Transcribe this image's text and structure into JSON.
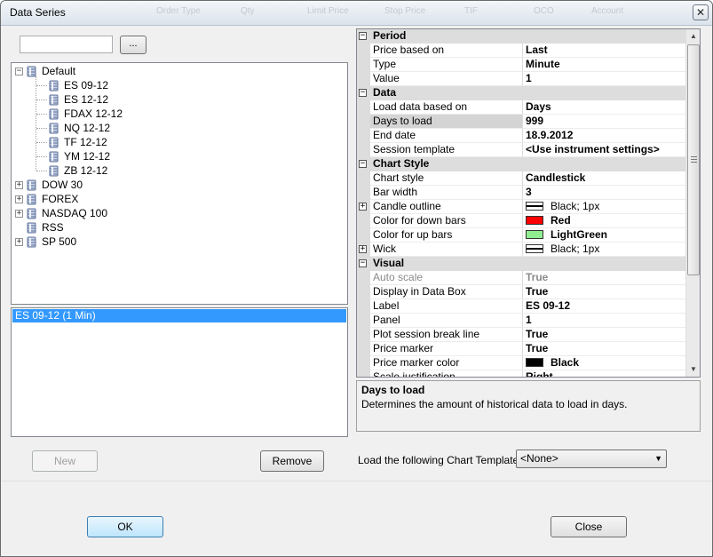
{
  "window": {
    "title": "Data Series",
    "close_glyph": "✕",
    "background_menu": [
      "Order Type",
      "Qty",
      "Limit Price",
      "Stop Price",
      "TIF",
      "OCO",
      "Account"
    ]
  },
  "search": {
    "value": "",
    "browse_label": "..."
  },
  "tree": [
    {
      "label": "Default",
      "expanded": true,
      "toggle": "−",
      "children": [
        "ES 09-12",
        "ES 12-12",
        "FDAX 12-12",
        "NQ 12-12",
        "TF 12-12",
        "YM 12-12",
        "ZB 12-12"
      ]
    },
    {
      "label": "DOW 30",
      "expanded": false,
      "toggle": "+"
    },
    {
      "label": "FOREX",
      "expanded": false,
      "toggle": "+"
    },
    {
      "label": "NASDAQ 100",
      "expanded": false,
      "toggle": "+"
    },
    {
      "label": "RSS",
      "expanded": false,
      "toggle": ""
    },
    {
      "label": "SP 500",
      "expanded": false,
      "toggle": "+"
    }
  ],
  "series_list": {
    "items": [
      "ES 09-12 (1 Min)"
    ]
  },
  "buttons": {
    "new": "New",
    "remove": "Remove",
    "ok": "OK",
    "close": "Close"
  },
  "properties": [
    {
      "category": "Period",
      "rows": [
        {
          "name": "Price based on",
          "value": "Last"
        },
        {
          "name": "Type",
          "value": "Minute"
        },
        {
          "name": "Value",
          "value": "1"
        }
      ]
    },
    {
      "category": "Data",
      "rows": [
        {
          "name": "Load data based on",
          "value": "Days"
        },
        {
          "name": "Days to load",
          "value": "999",
          "selected": true
        },
        {
          "name": "End date",
          "value": "18.9.2012"
        },
        {
          "name": "Session template",
          "value": "<Use instrument settings>"
        }
      ]
    },
    {
      "category": "Chart Style",
      "rows": [
        {
          "name": "Chart style",
          "value": "Candlestick"
        },
        {
          "name": "Bar width",
          "value": "3"
        },
        {
          "name": "Candle outline",
          "value": "Black; 1px",
          "expandable": true,
          "swatch": "stroke"
        },
        {
          "name": "Color for down bars",
          "value": "Red",
          "swatch": "#ff0000"
        },
        {
          "name": "Color for up bars",
          "value": "LightGreen",
          "swatch": "#90ee90"
        },
        {
          "name": "Wick",
          "value": "Black; 1px",
          "expandable": true,
          "swatch": "stroke"
        }
      ]
    },
    {
      "category": "Visual",
      "rows": [
        {
          "name": "Auto scale",
          "value": "True",
          "disabled": true
        },
        {
          "name": "Display in Data Box",
          "value": "True"
        },
        {
          "name": "Label",
          "value": "ES 09-12"
        },
        {
          "name": "Panel",
          "value": "1"
        },
        {
          "name": "Plot session break line",
          "value": "True"
        },
        {
          "name": "Price marker",
          "value": "True"
        },
        {
          "name": "Price marker color",
          "value": "Black",
          "swatch": "#000000"
        },
        {
          "name": "Scale justification",
          "value": "Right"
        }
      ]
    }
  ],
  "description": {
    "title": "Days to load",
    "text": "Determines the amount of historical data to load in days."
  },
  "chart_template": {
    "label": "Load the following Chart Template:",
    "value": "<None>"
  },
  "colors": {
    "selection": "#3399ff",
    "category_bg": "#dddddd",
    "down_bars": "#ff0000",
    "up_bars": "#90ee90"
  }
}
